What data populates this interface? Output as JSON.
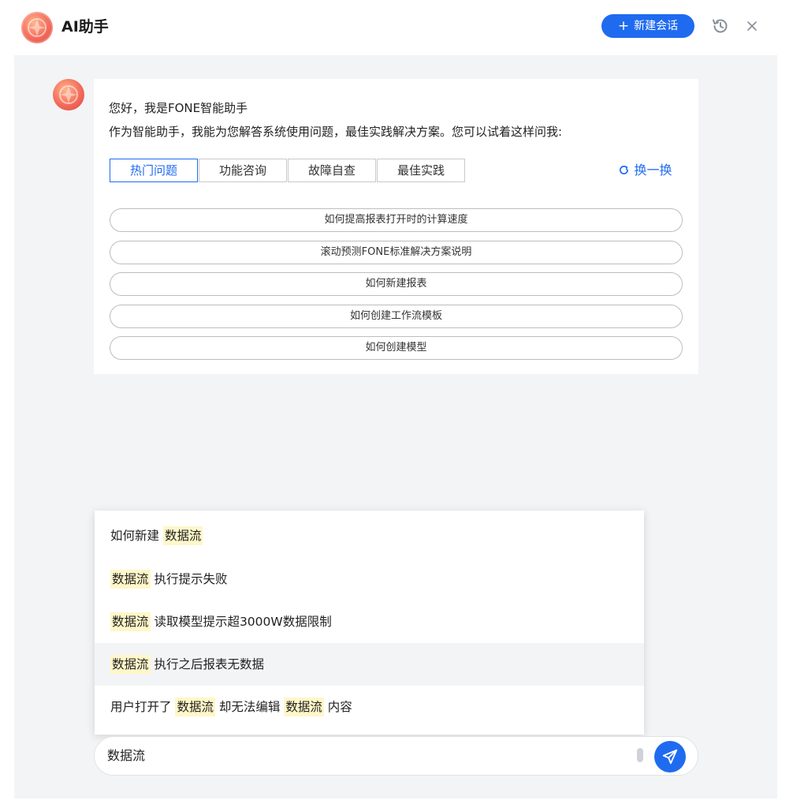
{
  "header": {
    "title": "AI助手",
    "new_chat_label": "新建会话"
  },
  "welcome": {
    "line1": "您好，我是FONE智能助手",
    "line2": "作为智能助手，我能为您解答系统使用问题，最佳实践解决方案。您可以试着这样问我:"
  },
  "tabs": [
    {
      "label": "热门问题",
      "active": true
    },
    {
      "label": "功能咨询",
      "active": false
    },
    {
      "label": "故障自查",
      "active": false
    },
    {
      "label": "最佳实践",
      "active": false
    }
  ],
  "refresh_label": "换一换",
  "questions": [
    "如何提高报表打开时的计算速度",
    "滚动预测FONE标准解决方案说明",
    "如何新建报表",
    "如何创建工作流模板",
    "如何创建模型"
  ],
  "suggestions": [
    {
      "parts": [
        {
          "t": "如何新建 ",
          "hl": false
        },
        {
          "t": "数据流",
          "hl": true
        }
      ]
    },
    {
      "parts": [
        {
          "t": "数据流",
          "hl": true
        },
        {
          "t": " 执行提示失败",
          "hl": false
        }
      ]
    },
    {
      "parts": [
        {
          "t": "数据流",
          "hl": true
        },
        {
          "t": " 读取模型提示超3000W数据限制",
          "hl": false
        }
      ]
    },
    {
      "parts": [
        {
          "t": "数据流",
          "hl": true
        },
        {
          "t": " 执行之后报表无数据",
          "hl": false
        }
      ],
      "hover": true
    },
    {
      "parts": [
        {
          "t": "用户打开了 ",
          "hl": false
        },
        {
          "t": "数据流",
          "hl": true
        },
        {
          "t": " 却无法编辑 ",
          "hl": false
        },
        {
          "t": "数据流",
          "hl": true
        },
        {
          "t": " 内容",
          "hl": false
        }
      ]
    }
  ],
  "input": {
    "value": "数据流"
  },
  "colors": {
    "accent": "#1f6bf0",
    "highlight": "#fff7c9",
    "chat_bg": "#f3f4f6"
  },
  "icons": {
    "logo": "fone-logo-icon",
    "history": "history-icon",
    "close": "close-icon",
    "refresh": "refresh-icon",
    "send": "send-icon"
  }
}
